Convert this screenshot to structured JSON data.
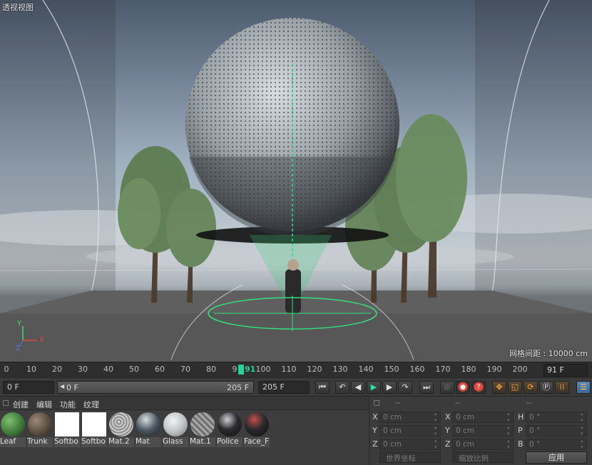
{
  "viewport": {
    "title": "透视视图",
    "grid_spacing": "网格间距 : 10000 cm",
    "axis_x": "X",
    "axis_y": "Y",
    "axis_z": "Z"
  },
  "timeline": {
    "ticks": [
      "0",
      "10",
      "20",
      "30",
      "40",
      "50",
      "60",
      "70",
      "80",
      "9",
      "91",
      "100",
      "110",
      "120",
      "130",
      "140",
      "150",
      "160",
      "170",
      "180",
      "190",
      "200"
    ],
    "current_frame": "91 F"
  },
  "transport": {
    "start_field": "0 F",
    "range_start": "0 F",
    "range_end": "205 F",
    "end_field": "205 F"
  },
  "material_manager": {
    "menu": [
      "创建",
      "编辑",
      "功能",
      "纹理"
    ],
    "materials": [
      {
        "name": "Leaf",
        "color": "#3f7a3a"
      },
      {
        "name": "Trunk",
        "color": "#5a4d40"
      },
      {
        "name": "Softbo",
        "color": "#ffffff"
      },
      {
        "name": "Softbo",
        "color": "#ffffff"
      },
      {
        "name": "Mat.2",
        "color": "#9a9a9a"
      },
      {
        "name": "Mat",
        "color": "#4a5660"
      },
      {
        "name": "Glass",
        "color": "#bfc4c7"
      },
      {
        "name": "Mat.1",
        "color": "#8a8a8a"
      },
      {
        "name": "Police",
        "color": "#2c2c30"
      },
      {
        "name": "Face_F",
        "color": "#2a2a2e"
      }
    ]
  },
  "coordinates": {
    "headers": [
      "--",
      "--",
      "--"
    ],
    "pos": [
      {
        "axis": "X",
        "value": "0 cm"
      },
      {
        "axis": "Y",
        "value": "0 cm"
      },
      {
        "axis": "Z",
        "value": "0 cm"
      }
    ],
    "size": [
      {
        "axis": "X",
        "value": "0 cm"
      },
      {
        "axis": "Y",
        "value": "0 cm"
      },
      {
        "axis": "Z",
        "value": "0 cm"
      }
    ],
    "rot": [
      {
        "axis": "H",
        "value": "0 °"
      },
      {
        "axis": "P",
        "value": "0 °"
      },
      {
        "axis": "B",
        "value": "0 °"
      }
    ],
    "world_coords": "世界坐标",
    "scale": "缩放比例",
    "apply": "应用"
  }
}
